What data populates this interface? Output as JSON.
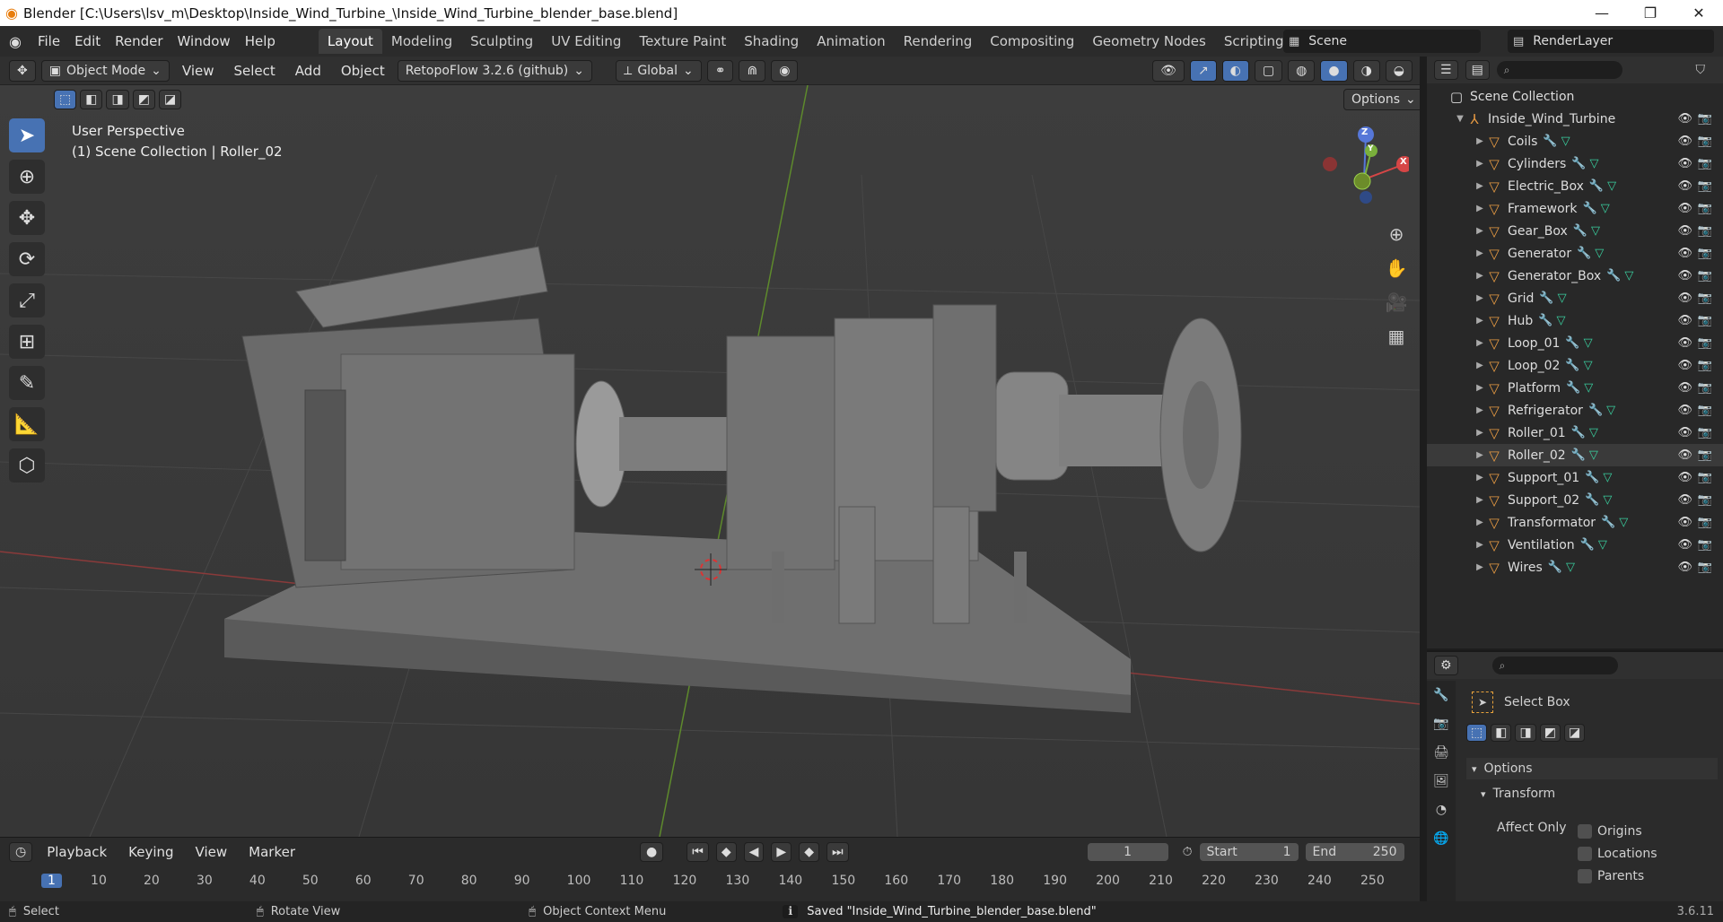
{
  "window": {
    "title": "Blender [C:\\Users\\lsv_m\\Desktop\\Inside_Wind_Turbine_\\Inside_Wind_Turbine_blender_base.blend]",
    "controls": {
      "minimize": "—",
      "maximize": "❐",
      "close": "✕"
    }
  },
  "menu": {
    "items": [
      "File",
      "Edit",
      "Render",
      "Window",
      "Help"
    ],
    "workspaces": [
      "Layout",
      "Modeling",
      "Sculpting",
      "UV Editing",
      "Texture Paint",
      "Shading",
      "Animation",
      "Rendering",
      "Compositing",
      "Geometry Nodes",
      "Scripting"
    ],
    "active_workspace": "Layout",
    "add_workspace": "+",
    "scene": "Scene",
    "render_layer": "RenderLayer"
  },
  "viewport_header": {
    "mode": "Object Mode",
    "menus": [
      "View",
      "Select",
      "Add",
      "Object"
    ],
    "addon": "RetopoFlow 3.2.6 (github)",
    "orientation": "Global",
    "options": "Options"
  },
  "viewport": {
    "perspective": "User Perspective",
    "collection_info": "(1) Scene Collection | Roller_02",
    "axes": {
      "z": "Z",
      "y": "Y",
      "x": "X"
    }
  },
  "outliner": {
    "root": "Scene Collection",
    "collection": "Inside_Wind_Turbine",
    "objects": [
      "Coils",
      "Cylinders",
      "Electric_Box",
      "Framework",
      "Gear_Box",
      "Generator",
      "Generator_Box",
      "Grid",
      "Hub",
      "Loop_01",
      "Loop_02",
      "Platform",
      "Refrigerator",
      "Roller_01",
      "Roller_02",
      "Support_01",
      "Support_02",
      "Transformator",
      "Ventilation",
      "Wires"
    ],
    "active_object": "Roller_02"
  },
  "properties": {
    "tool": "Select Box",
    "options_label": "Options",
    "transform_label": "Transform",
    "affect_only": "Affect Only",
    "checkboxes": [
      "Origins",
      "Locations",
      "Parents"
    ]
  },
  "timeline": {
    "menus": [
      "Playback",
      "Keying",
      "View",
      "Marker"
    ],
    "current_frame": "1",
    "start_label": "Start",
    "start": "1",
    "end_label": "End",
    "end": "250",
    "ticks": [
      "1",
      "10",
      "20",
      "30",
      "40",
      "50",
      "60",
      "70",
      "80",
      "90",
      "100",
      "110",
      "120",
      "130",
      "140",
      "150",
      "160",
      "170",
      "180",
      "190",
      "200",
      "210",
      "220",
      "230",
      "240",
      "250"
    ]
  },
  "status": {
    "select": "Select",
    "rotate": "Rotate View",
    "context": "Object Context Menu",
    "message": "Saved \"Inside_Wind_Turbine_blender_base.blend\"",
    "version": "3.6.11"
  }
}
